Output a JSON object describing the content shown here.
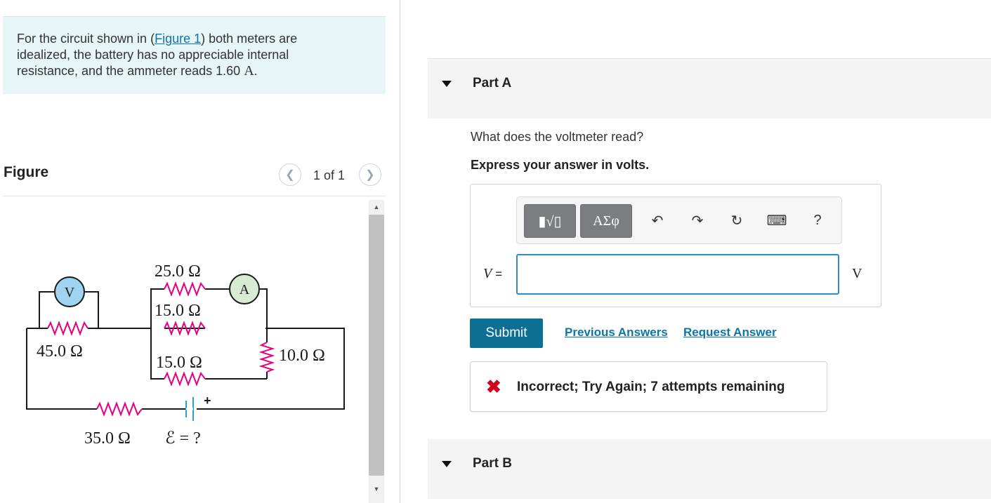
{
  "problem": {
    "text_before": "For the circuit shown in (",
    "figure_link": "Figure 1",
    "text_after": ") both meters are idealized, the battery has no appreciable internal resistance, and the ammeter reads 1.60 ",
    "unit": "A",
    "period": "."
  },
  "figure": {
    "label": "Figure",
    "pager": "1 of 1",
    "circuit": {
      "meters": [
        "V",
        "A"
      ],
      "resistors": [
        "25.0 Ω",
        "15.0 Ω",
        "45.0 Ω",
        "15.0 Ω",
        "10.0 Ω",
        "35.0 Ω"
      ],
      "emf_label": "ℰ = ?",
      "battery_sign": "+"
    }
  },
  "partA": {
    "title": "Part A",
    "question": "What does the voltmeter read?",
    "instruction": "Express your answer in volts.",
    "toolbar": {
      "templates_label": "▮√▯",
      "symbols_label": "ΑΣφ",
      "undo_icon": "↶",
      "redo_icon": "↷",
      "reset_icon": "↻",
      "keyboard_icon": "⌨",
      "help_label": "?"
    },
    "variable": "V",
    "equals": "=",
    "input_value": "",
    "unit": "V",
    "submit_label": "Submit",
    "previous_answers_label": "Previous Answers",
    "request_answer_label": "Request Answer",
    "feedback_icon": "✖",
    "feedback_text": "Incorrect; Try Again; 7 attempts remaining"
  },
  "partB": {
    "title": "Part B"
  },
  "colors": {
    "accent": "#0b76a8",
    "submit": "#0e6f95",
    "error": "#d0021b",
    "wire": "#1a1a1a",
    "resistor": "#e6007e",
    "voltmeter_fill": "#9fd3ef",
    "ammeter_fill": "#d7ead2",
    "battery": "#2aa0d8"
  }
}
